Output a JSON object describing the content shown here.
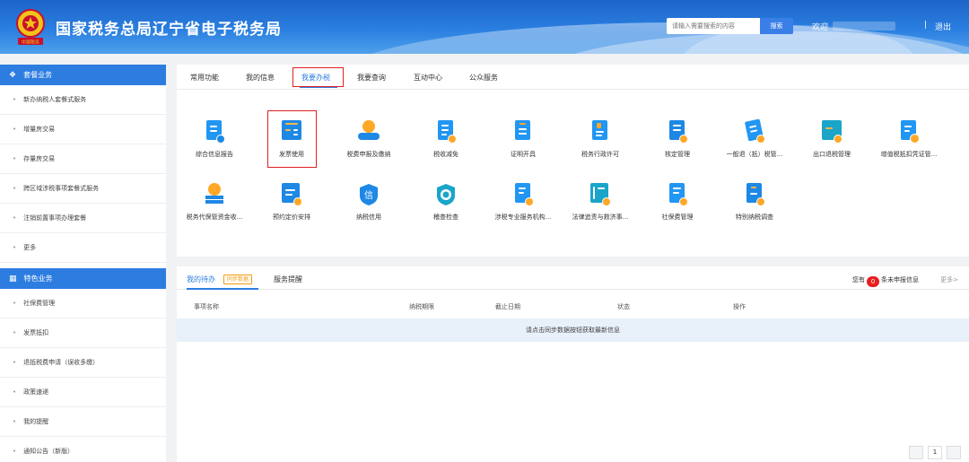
{
  "header": {
    "title": "国家税务总局辽宁省电子税务局",
    "emblem_text": "中国税务",
    "search_placeholder": "请输入需要搜索的内容",
    "search_button": "搜索",
    "welcome": "欢迎",
    "separator": "|",
    "logout": "退出",
    "colors": {
      "primary": "#2d7de0",
      "highlight": "#e02020"
    }
  },
  "sidebar": {
    "section1": {
      "title": "套餐业务",
      "icon": "layers-icon",
      "items": [
        "新办纳税人套餐式服务",
        "增量房交易",
        "存量房交易",
        "跨区域涉税事项套餐式服务",
        "注销前置事项办理套餐",
        "更多"
      ]
    },
    "section2": {
      "title": "特色业务",
      "icon": "grid-icon",
      "items": [
        "社保费管理",
        "发票抵扣",
        "退抵税费申请（误收多缴）",
        "政策速递",
        "我的提醒",
        "通知公告（新版）"
      ]
    }
  },
  "main": {
    "tabs": [
      "常用功能",
      "我的信息",
      "我要办税",
      "我要查询",
      "互动中心",
      "公众服务"
    ],
    "active_tab": "我要办税",
    "services_row1": [
      {
        "label": "综合信息报告",
        "icon": "report-icon"
      },
      {
        "label": "发票使用",
        "icon": "invoice-icon"
      },
      {
        "label": "税费申报及缴纳",
        "icon": "tax-payment-icon"
      },
      {
        "label": "税收减免",
        "icon": "tax-relief-icon"
      },
      {
        "label": "证明开具",
        "icon": "certificate-icon"
      },
      {
        "label": "税务行政许可",
        "icon": "license-icon"
      },
      {
        "label": "核定管理",
        "icon": "assessment-icon"
      },
      {
        "label": "一般退（抵）税管...",
        "icon": "refund-icon"
      },
      {
        "label": "出口退税管理",
        "icon": "export-refund-icon"
      },
      {
        "label": "增值税抵扣凭证管...",
        "icon": "vat-voucher-icon"
      }
    ],
    "services_row2": [
      {
        "label": "税务代保管资金收...",
        "icon": "custody-fund-icon"
      },
      {
        "label": "预约定价安排",
        "icon": "pricing-arrangement-icon"
      },
      {
        "label": "纳税信用",
        "icon": "credit-icon"
      },
      {
        "label": "稽查检查",
        "icon": "inspection-icon"
      },
      {
        "label": "涉税专业服务机构...",
        "icon": "agency-icon"
      },
      {
        "label": "法律追责与救济事...",
        "icon": "legal-icon"
      },
      {
        "label": "社保费管理",
        "icon": "social-security-icon"
      },
      {
        "label": "特别纳税调查",
        "icon": "special-investigation-icon"
      }
    ]
  },
  "todo": {
    "tabs": [
      "我的待办",
      "服务提醒"
    ],
    "sync_label": "同步数据",
    "pending_prefix": "您有",
    "pending_count": "0",
    "pending_suffix": "条未申报信息",
    "more": "更多>",
    "columns": [
      "事项名称",
      "纳税期限",
      "截止日期",
      "状态",
      "操作"
    ],
    "empty_message": "请点击同步数据按钮获取最新信息",
    "page": "1"
  }
}
